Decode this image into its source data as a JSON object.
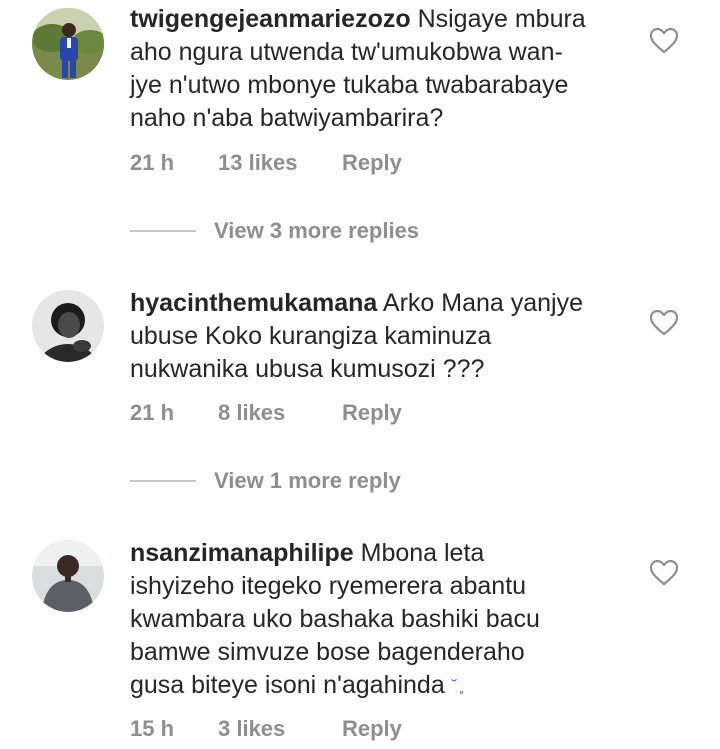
{
  "comments": [
    {
      "username": "twigengejeanmariezozo",
      "lines": [
        " Nsigaye mbura",
        "aho ngura utwenda tw'umukobwa wan-",
        "jye n'utwo mbonye tukaba twabarabaye",
        "naho n'aba batwiyambarira?"
      ],
      "time": "21 h",
      "likes": "13 likes",
      "reply": "Reply",
      "view_more": "View 3 more replies"
    },
    {
      "username": "hyacinthemukamana",
      "lines": [
        " Arko Mana yanjye",
        "ubuse Koko kurangiza kaminuza",
        "nukwanika ubusa kumusozi ???"
      ],
      "time": "21 h",
      "likes": "8 likes",
      "reply": "Reply",
      "view_more": "View 1 more reply"
    },
    {
      "username": "nsanzimanaphilipe",
      "lines": [
        " Mbona leta",
        "ishyizeho itegeko ryemerera abantu",
        "kwambara uko bashaka bashiki bacu",
        "bamwe simvuze bose bagenderaho",
        "gusa biteye isoni n'agahinda "
      ],
      "emoji": "˘ ̥",
      "time": "15 h",
      "likes": "3 likes",
      "reply": "Reply"
    }
  ],
  "colors": {
    "text": "#262626",
    "muted": "#8e8e8e",
    "divider": "#c7c7c7",
    "background": "#ffffff"
  },
  "icons": {
    "like": "heart-outline-icon"
  }
}
